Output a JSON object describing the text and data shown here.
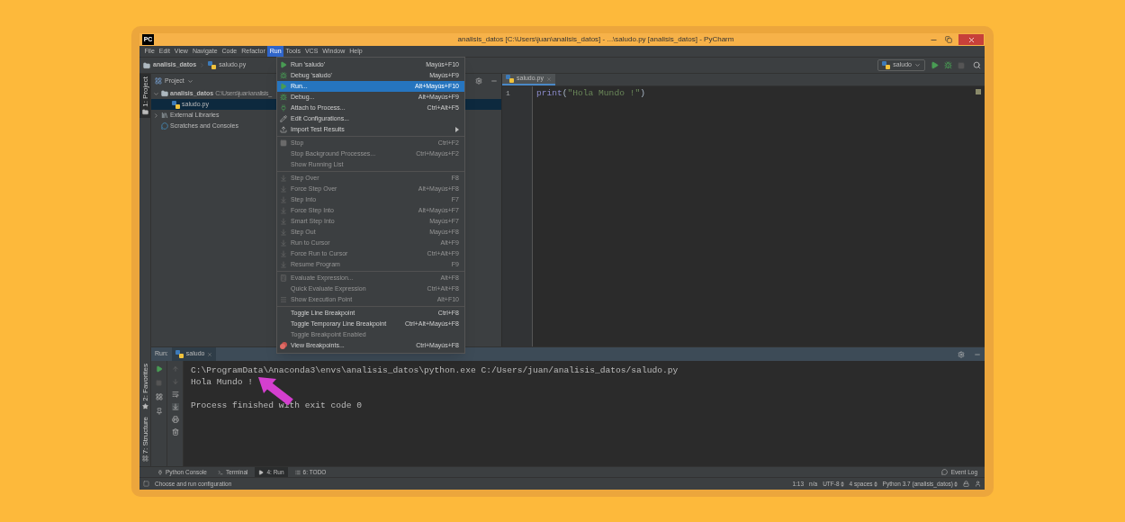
{
  "window": {
    "logo": "PC",
    "title": "analisis_datos [C:\\Users\\juan\\analisis_datos] - ...\\saludo.py [analisis_datos] - PyCharm"
  },
  "menu_bar": [
    {
      "label": "File",
      "selected": false
    },
    {
      "label": "Edit",
      "selected": false
    },
    {
      "label": "View",
      "selected": false
    },
    {
      "label": "Navigate",
      "selected": false
    },
    {
      "label": "Code",
      "selected": false
    },
    {
      "label": "Refactor",
      "selected": false
    },
    {
      "label": "Run",
      "selected": true
    },
    {
      "label": "Tools",
      "selected": false
    },
    {
      "label": "VCS",
      "selected": false
    },
    {
      "label": "Window",
      "selected": false
    },
    {
      "label": "Help",
      "selected": false
    }
  ],
  "breadcrumb": [
    "analisis_datos",
    "saludo.py"
  ],
  "run_config": {
    "label": "saludo"
  },
  "side_stripe": {
    "top": [
      {
        "label": "1: Project",
        "selected": true
      }
    ],
    "bottom": [
      {
        "label": "2: Favorites",
        "selected": false
      },
      {
        "label": "7: Structure",
        "selected": false
      }
    ]
  },
  "project_panel": {
    "title": "Project",
    "tree": [
      {
        "label": "analisis_datos",
        "path": "C:\\Users\\juan\\analisis_",
        "kind": "folder",
        "expanded": true,
        "selected": false,
        "children": [
          {
            "label": "saludo.py",
            "kind": "python",
            "selected": true
          }
        ]
      },
      {
        "label": "External Libraries",
        "kind": "library",
        "expanded": false,
        "selected": false
      },
      {
        "label": "Scratches and Consoles",
        "kind": "scratch",
        "selected": false
      }
    ]
  },
  "editor": {
    "tabs": [
      {
        "label": "saludo.py",
        "selected": true
      }
    ],
    "lines": [
      {
        "number": "1",
        "tokens": [
          {
            "kind": "builtin",
            "text": "print"
          },
          {
            "kind": "punct",
            "text": "("
          },
          {
            "kind": "string",
            "text": "\"Hola Mundo !\""
          },
          {
            "kind": "punct",
            "text": ")"
          }
        ]
      }
    ]
  },
  "run_menu": {
    "groups": [
      [
        {
          "label": "Run 'saludo'",
          "shortcut": "Mayús+F10",
          "disabled": false,
          "selected": false,
          "submenu": false
        },
        {
          "label": "Debug 'saludo'",
          "shortcut": "Mayús+F9",
          "disabled": false,
          "selected": false,
          "submenu": false
        },
        {
          "label": "Run...",
          "shortcut": "Alt+Mayús+F10",
          "disabled": false,
          "selected": true,
          "submenu": false
        },
        {
          "label": "Debug...",
          "shortcut": "Alt+Mayús+F9",
          "disabled": false,
          "selected": false,
          "submenu": false
        },
        {
          "label": "Attach to Process...",
          "shortcut": "Ctrl+Alt+F5",
          "disabled": false,
          "selected": false,
          "submenu": false
        },
        {
          "label": "Edit Configurations...",
          "disabled": false,
          "selected": false,
          "submenu": false
        },
        {
          "label": "Import Test Results",
          "disabled": false,
          "selected": false,
          "submenu": true
        }
      ],
      [
        {
          "label": "Stop",
          "shortcut": "Ctrl+F2",
          "disabled": true,
          "selected": false,
          "submenu": false
        },
        {
          "label": "Stop Background Processes...",
          "shortcut": "Ctrl+Mayús+F2",
          "disabled": true,
          "selected": false,
          "submenu": false
        },
        {
          "label": "Show Running List",
          "disabled": true,
          "selected": false,
          "submenu": false
        }
      ],
      [
        {
          "label": "Step Over",
          "shortcut": "F8",
          "disabled": true,
          "selected": false,
          "submenu": false
        },
        {
          "label": "Force Step Over",
          "shortcut": "Alt+Mayús+F8",
          "disabled": true,
          "selected": false,
          "submenu": false
        },
        {
          "label": "Step Into",
          "shortcut": "F7",
          "disabled": true,
          "selected": false,
          "submenu": false
        },
        {
          "label": "Force Step Into",
          "shortcut": "Alt+Mayús+F7",
          "disabled": true,
          "selected": false,
          "submenu": false
        },
        {
          "label": "Smart Step Into",
          "shortcut": "Mayús+F7",
          "disabled": true,
          "selected": false,
          "submenu": false
        },
        {
          "label": "Step Out",
          "shortcut": "Mayús+F8",
          "disabled": true,
          "selected": false,
          "submenu": false
        },
        {
          "label": "Run to Cursor",
          "shortcut": "Alt+F9",
          "disabled": true,
          "selected": false,
          "submenu": false
        },
        {
          "label": "Force Run to Cursor",
          "shortcut": "Ctrl+Alt+F9",
          "disabled": true,
          "selected": false,
          "submenu": false
        },
        {
          "label": "Resume Program",
          "shortcut": "F9",
          "disabled": true,
          "selected": false,
          "submenu": false
        }
      ],
      [
        {
          "label": "Evaluate Expression...",
          "shortcut": "Alt+F8",
          "disabled": true,
          "selected": false,
          "submenu": false
        },
        {
          "label": "Quick Evaluate Expression",
          "shortcut": "Ctrl+Alt+F8",
          "disabled": true,
          "selected": false,
          "submenu": false
        },
        {
          "label": "Show Execution Point",
          "shortcut": "Alt+F10",
          "disabled": true,
          "selected": false,
          "submenu": false
        }
      ],
      [
        {
          "label": "Toggle Line Breakpoint",
          "shortcut": "Ctrl+F8",
          "disabled": false,
          "selected": false,
          "submenu": false
        },
        {
          "label": "Toggle Temporary Line Breakpoint",
          "shortcut": "Ctrl+Alt+Mayús+F8",
          "disabled": false,
          "selected": false,
          "submenu": false
        },
        {
          "label": "Toggle Breakpoint Enabled",
          "disabled": true,
          "selected": false,
          "submenu": false
        },
        {
          "label": "View Breakpoints...",
          "shortcut": "Ctrl+Mayús+F8",
          "disabled": false,
          "selected": false,
          "submenu": false
        }
      ]
    ]
  },
  "run_panel": {
    "label": "Run:",
    "tabs": [
      {
        "label": "saludo",
        "selected": true
      }
    ],
    "console": [
      {
        "text": "C:\\ProgramData\\Anaconda3\\envs\\analisis_datos\\python.exe C:/Users/juan/analisis_datos/saludo.py",
        "blank_before": false
      },
      {
        "text": "Hola Mundo !",
        "blank_before": false
      },
      {
        "text": "Process finished with exit code 0",
        "blank_before": true
      }
    ]
  },
  "bottom_tabs": [
    {
      "label": "Python Console",
      "selected": false
    },
    {
      "label": "Terminal",
      "selected": false
    },
    {
      "label": "4: Run",
      "selected": true
    },
    {
      "label": "6: TODO",
      "selected": false
    }
  ],
  "event_log": "Event Log",
  "status_bar": {
    "message": "Choose and run configuration",
    "items": [
      {
        "label": "1:13",
        "dropdown": false
      },
      {
        "label": "n/a",
        "dropdown": false
      },
      {
        "label": "UTF-8",
        "dropdown": true
      },
      {
        "label": "4 spaces",
        "dropdown": true
      },
      {
        "label": "Python 3.7 (analisis_datos)",
        "dropdown": true
      }
    ]
  }
}
